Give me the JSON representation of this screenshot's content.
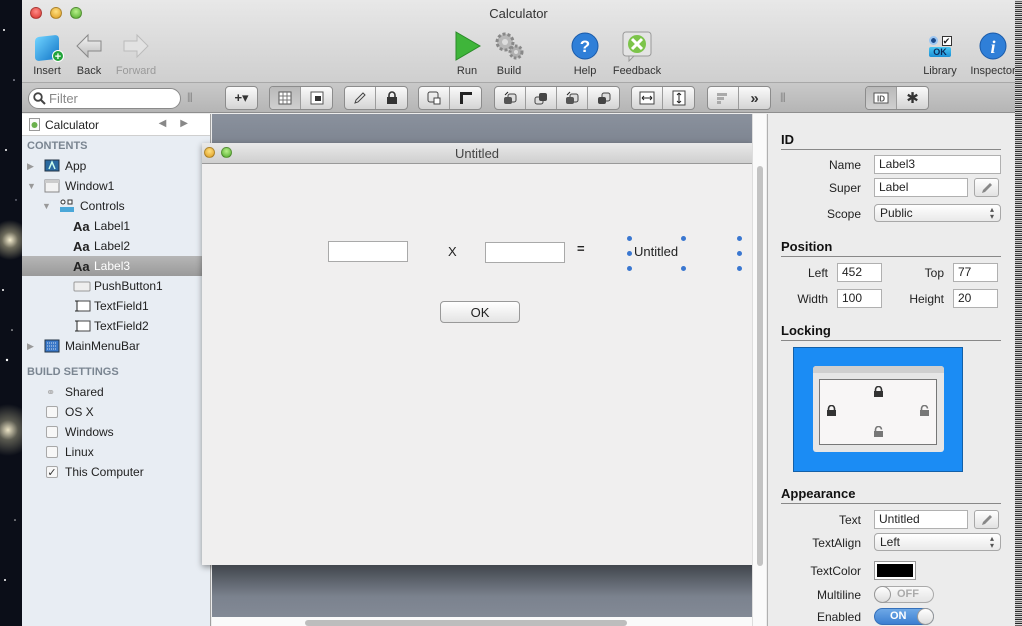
{
  "window": {
    "title": "Calculator"
  },
  "toolbar": {
    "items": [
      {
        "id": "insert",
        "label": "Insert",
        "icon": "insert-cube-icon"
      },
      {
        "id": "back",
        "label": "Back",
        "icon": "back-arrow-icon"
      },
      {
        "id": "forward",
        "label": "Forward",
        "icon": "forward-arrow-icon",
        "disabled": true
      },
      {
        "id": "run",
        "label": "Run",
        "icon": "run-play-icon"
      },
      {
        "id": "build",
        "label": "Build",
        "icon": "build-gears-icon"
      },
      {
        "id": "help",
        "label": "Help",
        "icon": "help-icon"
      },
      {
        "id": "feedback",
        "label": "Feedback",
        "icon": "feedback-icon"
      },
      {
        "id": "library",
        "label": "Library",
        "icon": "library-icon"
      },
      {
        "id": "inspector",
        "label": "Inspector",
        "icon": "info-icon"
      }
    ],
    "library_ok": "OK"
  },
  "toolbar2": {
    "filter_placeholder": "Filter",
    "add_label": "+▾"
  },
  "sidebar": {
    "project": "Calculator",
    "contents_header": "CONTENTS",
    "tree": [
      {
        "label": "App",
        "level": 0,
        "disclosure": "collapsed",
        "icon": "app-icon"
      },
      {
        "label": "Window1",
        "level": 0,
        "disclosure": "expanded",
        "icon": "window-icon"
      },
      {
        "label": "Controls",
        "level": 1,
        "disclosure": "expanded",
        "icon": "controls-icon"
      },
      {
        "label": "Label1",
        "level": 2,
        "icon": "label-aa-icon"
      },
      {
        "label": "Label2",
        "level": 2,
        "icon": "label-aa-icon"
      },
      {
        "label": "Label3",
        "level": 2,
        "icon": "label-aa-icon",
        "selected": true
      },
      {
        "label": "PushButton1",
        "level": 2,
        "icon": "pushbutton-icon"
      },
      {
        "label": "TextField1",
        "level": 2,
        "icon": "textfield-icon"
      },
      {
        "label": "TextField2",
        "level": 2,
        "icon": "textfield-icon"
      },
      {
        "label": "MainMenuBar",
        "level": 0,
        "disclosure": "collapsed",
        "icon": "menubar-icon"
      }
    ],
    "build_header": "BUILD SETTINGS",
    "build": [
      {
        "label": "Shared",
        "type": "shared"
      },
      {
        "label": "OS X",
        "checked": false
      },
      {
        "label": "Windows",
        "checked": false
      },
      {
        "label": "Linux",
        "checked": false
      },
      {
        "label": "This Computer",
        "checked": true
      }
    ]
  },
  "designer": {
    "window_title": "Untitled",
    "times_label": "X",
    "equals_label": "=",
    "result_label": "Untitled",
    "button_label": "OK"
  },
  "inspector": {
    "id_header": "ID",
    "name_label": "Name",
    "name_value": "Label3",
    "super_label": "Super",
    "super_value": "Label",
    "scope_label": "Scope",
    "scope_value": "Public",
    "position_header": "Position",
    "left_label": "Left",
    "left_value": "452",
    "top_label": "Top",
    "top_value": "77",
    "width_label": "Width",
    "width_value": "100",
    "height_label": "Height",
    "height_value": "20",
    "locking_header": "Locking",
    "locks": {
      "top": "locked",
      "left": "locked",
      "right": "unlocked",
      "bottom": "unlocked"
    },
    "appearance_header": "Appearance",
    "text_label": "Text",
    "text_value": "Untitled",
    "textalign_label": "TextAlign",
    "textalign_value": "Left",
    "textcolor_label": "TextColor",
    "textcolor_value": "#000000",
    "multiline_label": "Multiline",
    "multiline_value": "OFF",
    "enabled_label": "Enabled",
    "enabled_value": "ON"
  },
  "colors": {
    "accent": "#1b8cf4",
    "selection_handle": "#3a77d0",
    "toggle_on": "#3c7fd1"
  }
}
